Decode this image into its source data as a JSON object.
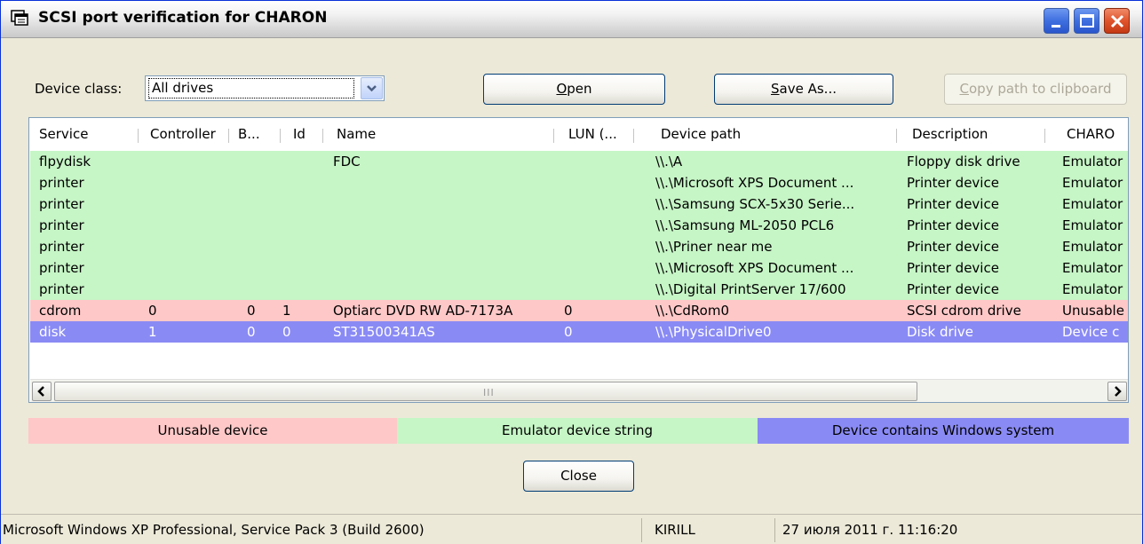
{
  "window": {
    "title": "SCSI port verification for CHARON",
    "icon": "windows-app-icon",
    "controls": [
      "minimize-icon",
      "maximize-icon",
      "close-icon"
    ]
  },
  "toolbar": {
    "device_class_label": "Device class:",
    "device_class_value": "All drives",
    "open_pre": "",
    "open_accel": "O",
    "open_post": "pen",
    "saveas_pre": "",
    "saveas_accel": "S",
    "saveas_post": "ave As...",
    "copy_pre": "",
    "copy_accel": "C",
    "copy_post": "opy path to clipboard"
  },
  "table": {
    "columns": [
      "Service",
      "Controller",
      "B...",
      "Id",
      "Name",
      "LUN (...",
      "Device path",
      "Description",
      "CHARO"
    ],
    "rows": [
      {
        "status": "green",
        "cells": [
          "flpydisk",
          "",
          "",
          "",
          "FDC",
          "",
          "\\\\.\\A",
          "Floppy disk drive",
          "Emulator"
        ]
      },
      {
        "status": "green",
        "cells": [
          "printer",
          "",
          "",
          "",
          "",
          "",
          "\\\\.\\Microsoft XPS Document ...",
          "Printer device",
          "Emulator"
        ]
      },
      {
        "status": "green",
        "cells": [
          "printer",
          "",
          "",
          "",
          "",
          "",
          "\\\\.\\Samsung SCX-5x30 Serie...",
          "Printer device",
          "Emulator"
        ]
      },
      {
        "status": "green",
        "cells": [
          "printer",
          "",
          "",
          "",
          "",
          "",
          "\\\\.\\Samsung ML-2050 PCL6",
          "Printer device",
          "Emulator"
        ]
      },
      {
        "status": "green",
        "cells": [
          "printer",
          "",
          "",
          "",
          "",
          "",
          "\\\\.\\Priner near me",
          "Printer device",
          "Emulator"
        ]
      },
      {
        "status": "green",
        "cells": [
          "printer",
          "",
          "",
          "",
          "",
          "",
          "\\\\.\\Microsoft XPS Document ...",
          "Printer device",
          "Emulator"
        ]
      },
      {
        "status": "green",
        "cells": [
          "printer",
          "",
          "",
          "",
          "",
          "",
          "\\\\.\\Digital PrintServer 17/600",
          "Printer device",
          "Emulator"
        ]
      },
      {
        "status": "red",
        "cells": [
          "cdrom",
          "0",
          "0",
          "1",
          "Optiarc DVD RW AD-7173A",
          "0",
          "\\\\.\\CdRom0",
          "SCSI cdrom drive",
          "Unusable"
        ]
      },
      {
        "status": "blue",
        "cells": [
          "disk",
          "1",
          "0",
          "0",
          "ST31500341AS",
          "0",
          "\\\\.\\PhysicalDrive0",
          "Disk drive",
          "Device c"
        ]
      }
    ],
    "scroll_grip": "III"
  },
  "legend": {
    "unusable": "Unusable device",
    "emulator": "Emulator device string",
    "windows": "Device contains Windows system"
  },
  "close_label": "Close",
  "status": {
    "os": "Microsoft Windows XP Professional, Service Pack 3 (Build 2600)",
    "host": "KIRILL",
    "datetime": "27 июля 2011 г. 11:16:20"
  },
  "colors": {
    "unusable": "#ffc8c8",
    "emulator": "#c6f5c6",
    "windows": "#8a8af5"
  }
}
